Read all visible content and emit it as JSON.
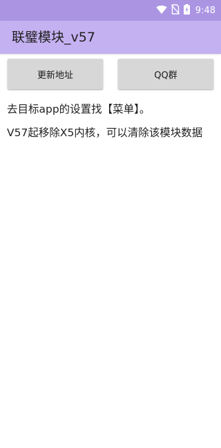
{
  "status_bar": {
    "time": "9:48",
    "icons": [
      "wifi-icon",
      "no-sim-icon",
      "battery-charging-icon"
    ]
  },
  "app_bar": {
    "title": "联璧模块_v57"
  },
  "buttons": {
    "update_label": "更新地址",
    "qq_label": "QQ群"
  },
  "content": {
    "paragraphs": [
      "去目标app的设置找【菜单】。",
      "V57起移除X5内核，可以清除该模块数据"
    ]
  },
  "colors": {
    "status_bar": "#ab95e3",
    "app_bar": "#c4b1f1",
    "button_bg": "#d7d7d7"
  }
}
